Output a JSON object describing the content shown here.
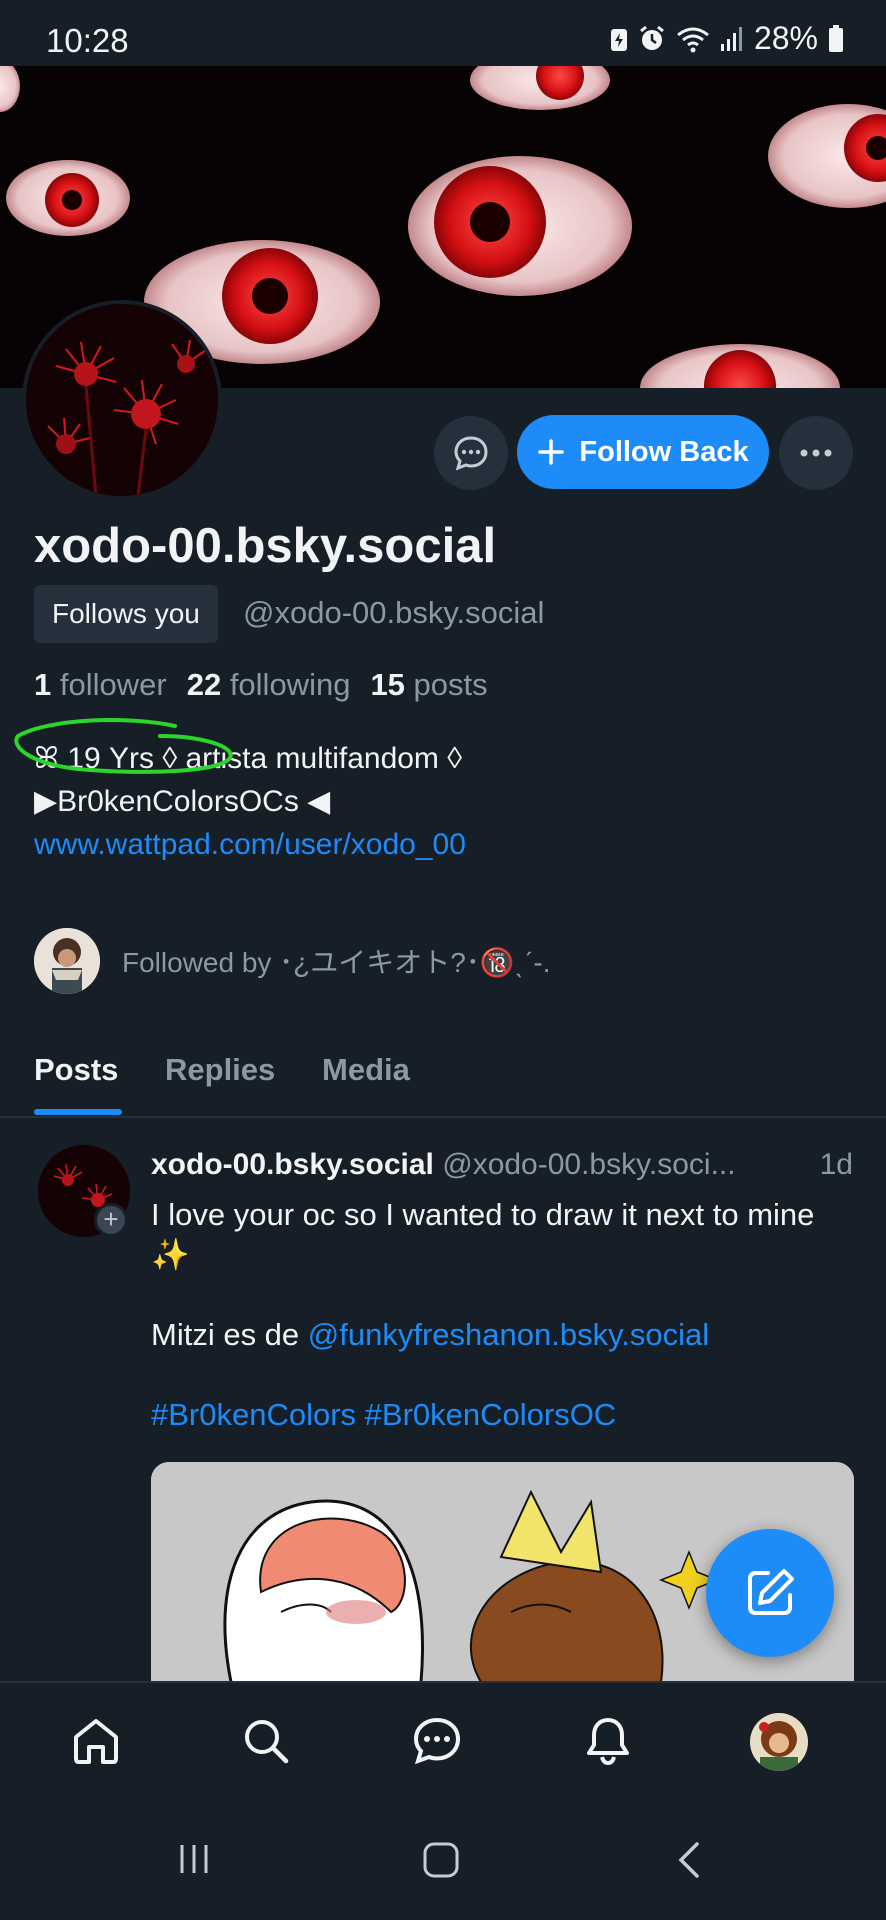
{
  "status_bar": {
    "time": "10:28",
    "battery": "28%",
    "icons": [
      "battery-saver-icon",
      "alarm-icon",
      "wifi-icon",
      "signal-icon",
      "battery-icon"
    ]
  },
  "profile": {
    "display_name": "xodo-00.bsky.social",
    "follows_you_badge": "Follows you",
    "handle": "@xodo-00.bsky.social",
    "follow_button": "Follow Back",
    "stats": {
      "followers_count": "1",
      "followers_label": "follower",
      "following_count": "22",
      "following_label": "following",
      "posts_count": "15",
      "posts_label": "posts"
    },
    "bio_line1": "ꕤ 19 Yrs ◊ artista multifandom ◊",
    "bio_line2": "▶Br0kenColorsOCs ◀",
    "bio_link": "www.wattpad.com/user/xodo_00",
    "followed_by": "Followed by ･¿ユイキオト?･🔞ˎˊ-."
  },
  "tabs": [
    {
      "label": "Posts",
      "active": true
    },
    {
      "label": "Replies",
      "active": false
    },
    {
      "label": "Media",
      "active": false
    }
  ],
  "post": {
    "author_name": "xodo-00.bsky.social",
    "author_handle": "@xodo-00.bsky.soci...",
    "time": "1d",
    "line1": "I love your oc so I wanted to draw it next to mine ✨",
    "line2_prefix": "Mitzi es de ",
    "line2_mention": "@funkyfreshanon.bsky.social",
    "hashtags": "#Br0kenColors #Br0kenColorsOC"
  },
  "colors": {
    "background": "#161e27",
    "accent": "#1d8cf8",
    "muted_text": "#8b98a5",
    "surface": "#26303c",
    "annotation": "#2bd62b"
  },
  "nav": {
    "items": [
      "home-icon",
      "search-icon",
      "chat-icon",
      "bell-icon",
      "profile-avatar"
    ]
  }
}
